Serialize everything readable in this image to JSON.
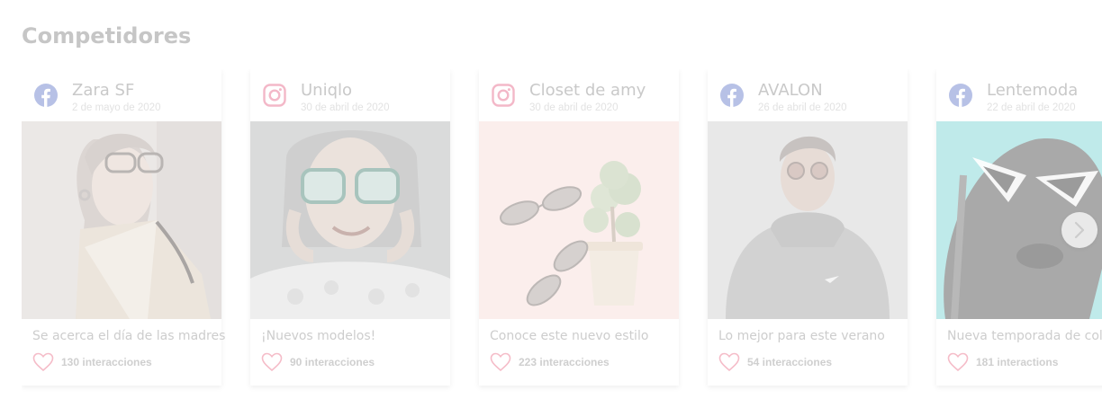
{
  "section": {
    "title": "Competidores"
  },
  "colors": {
    "facebook_icon": "#b7c1e6",
    "instagram_icon": "#f3b8c8",
    "heart": "#f5bcc8",
    "photo_mint": "#bfeaea"
  },
  "posts": [
    {
      "network": "facebook",
      "icon": "facebook-icon",
      "brand": "Zara SF",
      "date": "2 de mayo de 2020",
      "caption": "Se acerca el día de las madres",
      "interactions": "130 interacciones"
    },
    {
      "network": "instagram",
      "icon": "instagram-icon",
      "brand": "Uniqlo",
      "date": "30 de abril de 2020",
      "caption": "¡Nuevos modelos!",
      "interactions": "90 interacciones"
    },
    {
      "network": "instagram",
      "icon": "instagram-icon",
      "brand": "Closet de amy",
      "date": "30 de abril de 2020",
      "caption": "Conoce este nuevo estilo",
      "interactions": "223 interacciones"
    },
    {
      "network": "facebook",
      "icon": "facebook-icon",
      "brand": "AVALON",
      "date": "26 de abril de 2020",
      "caption": "Lo mejor para este verano",
      "interactions": "54 interacciones"
    },
    {
      "network": "facebook",
      "icon": "facebook-icon",
      "brand": "Lentemoda",
      "date": "22 de abril de 2020",
      "caption": "Nueva temporada de colores",
      "interactions": "181 interactions"
    }
  ],
  "carousel": {
    "next_icon": "chevron-right-icon"
  }
}
